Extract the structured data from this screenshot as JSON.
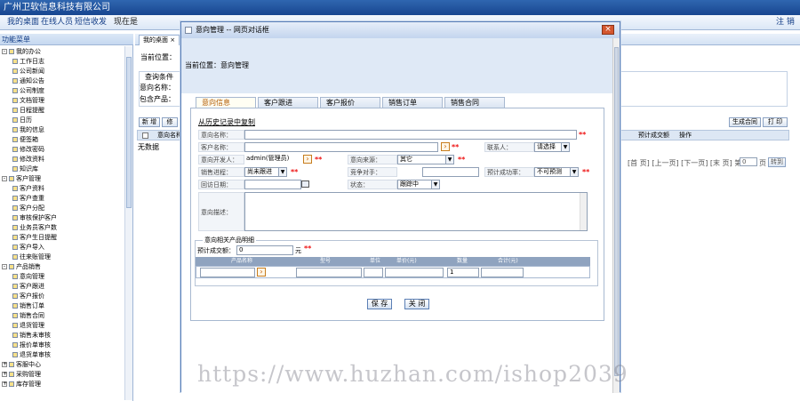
{
  "app": {
    "company_title": "广州卫软信息科技有限公司",
    "logout": "注 销"
  },
  "menubar": {
    "items": [
      "我的桌面",
      "在线人员",
      "短信收发",
      "现在是"
    ]
  },
  "sidebar": {
    "header": "功能菜单",
    "items": [
      {
        "label": "我的办公",
        "level": 0,
        "expand": "-"
      },
      {
        "label": "工作日志",
        "level": 1
      },
      {
        "label": "公司新闻",
        "level": 1
      },
      {
        "label": "通知公告",
        "level": 1
      },
      {
        "label": "公司制度",
        "level": 1
      },
      {
        "label": "文档管理",
        "level": 1
      },
      {
        "label": "日程提醒",
        "level": 1
      },
      {
        "label": "日历",
        "level": 1
      },
      {
        "label": "我的信息",
        "level": 1
      },
      {
        "label": "便签箱",
        "level": 1
      },
      {
        "label": "修改密码",
        "level": 1
      },
      {
        "label": "修改资料",
        "level": 1
      },
      {
        "label": "知识库",
        "level": 1
      },
      {
        "label": "客户管理",
        "level": 0,
        "expand": "-"
      },
      {
        "label": "客户资料",
        "level": 1
      },
      {
        "label": "客户查重",
        "level": 1
      },
      {
        "label": "客户分配",
        "level": 1
      },
      {
        "label": "审核保护客户",
        "level": 1
      },
      {
        "label": "业务员客户数",
        "level": 1
      },
      {
        "label": "客户生日提醒",
        "level": 1
      },
      {
        "label": "客户导入",
        "level": 1
      },
      {
        "label": "往来账管理",
        "level": 1
      },
      {
        "label": "产品销售",
        "level": 0,
        "expand": "-"
      },
      {
        "label": "意向管理",
        "level": 1
      },
      {
        "label": "客户跟进",
        "level": 1
      },
      {
        "label": "客户报价",
        "level": 1
      },
      {
        "label": "销售订单",
        "level": 1
      },
      {
        "label": "销售合同",
        "level": 1
      },
      {
        "label": "退货管理",
        "level": 1
      },
      {
        "label": "销售未审核",
        "level": 1
      },
      {
        "label": "报价单审核",
        "level": 1
      },
      {
        "label": "退货单审核",
        "level": 1
      },
      {
        "label": "客服中心",
        "level": 0,
        "expand": "+"
      },
      {
        "label": "采购管理",
        "level": 0,
        "expand": "+"
      },
      {
        "label": "库存管理",
        "level": 0,
        "expand": "+"
      }
    ]
  },
  "main": {
    "tab_label": "我的桌面",
    "location": "当前位置：",
    "query_label": "查询条件",
    "intent_name_label": "意向名称：",
    "product_label": "包含产品：",
    "buttons": [
      "新 增",
      "修"
    ],
    "right_buttons": [
      "生成合同",
      "打 印"
    ],
    "col_name": "意向名称",
    "col_est": "预计成交额",
    "col_op": "操作",
    "no_data": "无数据",
    "pager": "[首 页] [上一页] [下一页] [末 页] 第",
    "pager_page": "0",
    "pager_suffix": "页",
    "jump_button": "转到"
  },
  "dialog": {
    "title": "意向管理 -- 网页对话框",
    "close": "×",
    "location": "当前位置：意向管理",
    "tabs": [
      "意向信息",
      "客户跟进",
      "客户报价",
      "销售订单",
      "销售合同"
    ],
    "copy_link": "从历史记录中复制",
    "form": {
      "intent_name_label": "意向名称：",
      "customer_name_label": "客户名称：",
      "contact_label": "联系人：",
      "contact_value": "请选择",
      "developer_label": "意向开发人：",
      "developer_value": "admin(管理员)",
      "source_label": "意向来源：",
      "source_value": "其它",
      "stage_label": "销售进程：",
      "stage_value": "尚未跟进",
      "competitor_label": "竞争对手：",
      "success_rate_label": "预计成功率：",
      "success_rate_value": "不可预测",
      "visit_date_label": "回访日期：",
      "status_label": "状态：",
      "status_value": "跟踪中",
      "description_label": "意向描述："
    },
    "products": {
      "legend": "意向相关产品明细",
      "est_amount_label": "预计成交额：",
      "est_amount_value": "0",
      "unit": "元",
      "columns": [
        "产品名称",
        "型号",
        "单位",
        "单价(元)",
        "数量",
        "合计(元)"
      ],
      "qty_value": "1"
    },
    "save": "保 存",
    "close_button": "关 闭"
  },
  "watermark": "https://www.huzhan.com/ishop2039"
}
